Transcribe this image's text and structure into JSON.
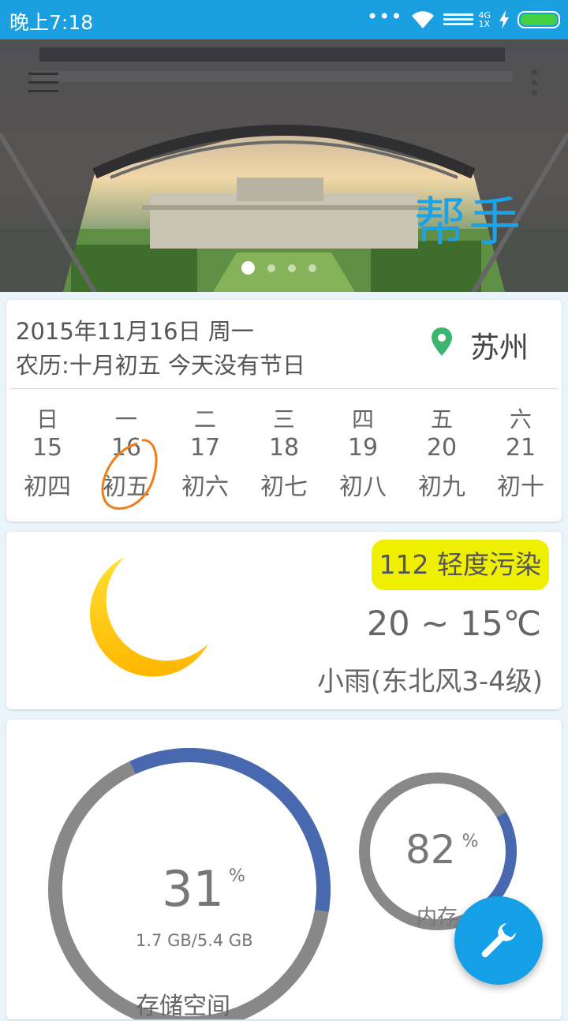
{
  "status_bar": {
    "time": "晚上7:18",
    "network_top": "4G",
    "network_bottom": "1X"
  },
  "banner": {
    "title": "帮手",
    "pages": 4,
    "active_page": 1
  },
  "date_card": {
    "date_line": "2015年11月16日 周一",
    "lunar_line": "农历:十月初五 今天没有节日",
    "city": "苏州",
    "week": [
      {
        "weekday": "日",
        "day": "15",
        "lunar": "初四"
      },
      {
        "weekday": "一",
        "day": "16",
        "lunar": "初五",
        "today": true
      },
      {
        "weekday": "二",
        "day": "17",
        "lunar": "初六"
      },
      {
        "weekday": "三",
        "day": "18",
        "lunar": "初七"
      },
      {
        "weekday": "四",
        "day": "19",
        "lunar": "初八"
      },
      {
        "weekday": "五",
        "day": "20",
        "lunar": "初九"
      },
      {
        "weekday": "六",
        "day": "21",
        "lunar": "初十"
      }
    ]
  },
  "weather_card": {
    "aqi": "112 轻度污染",
    "temperature": "20 ~ 15℃",
    "condition": "小雨(东北风3-4级)",
    "icon": "moon-icon"
  },
  "storage_card": {
    "storage": {
      "percent": "31",
      "unit": "%",
      "detail": "1.7 GB/5.4 GB",
      "label": "存储空间",
      "value": 31
    },
    "memory": {
      "percent": "82",
      "unit": "%",
      "label": "内存",
      "value": 82
    }
  },
  "colors": {
    "accent": "#1aa0e0",
    "gauge_fill": "#4869b0",
    "gauge_track": "#888888",
    "aqi_bg": "#eef000",
    "today_ring": "#f07d1a"
  }
}
